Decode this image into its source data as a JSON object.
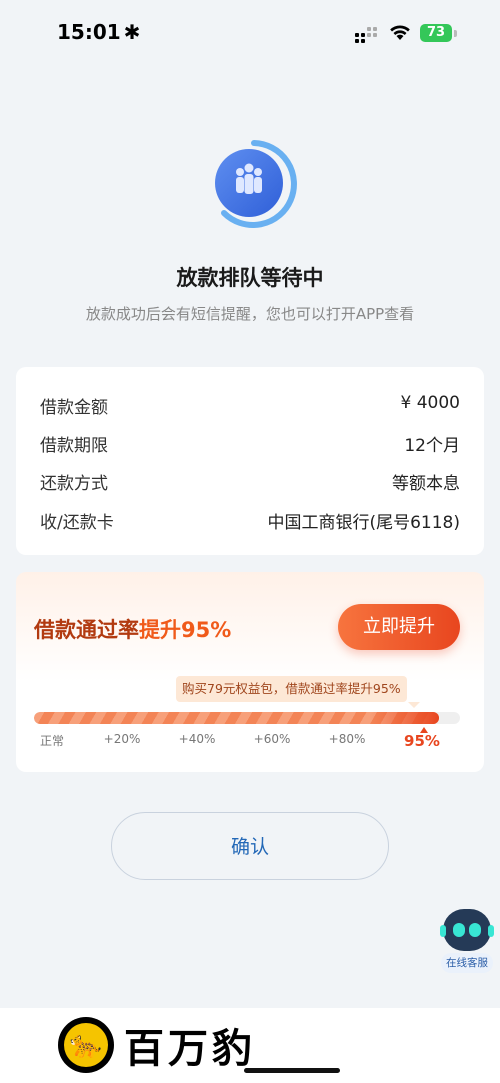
{
  "status_bar": {
    "time": "15:01",
    "sync_glyph": "✱",
    "battery": "73"
  },
  "header": {
    "title": "放款排队等待中",
    "subtitle": "放款成功后会有短信提醒，您也可以打开APP查看"
  },
  "loan_info": [
    {
      "label": "借款金额",
      "value": "¥ 4000"
    },
    {
      "label": "借款期限",
      "value": "12个月"
    },
    {
      "label": "还款方式",
      "value": "等额本息"
    },
    {
      "label": "收/还款卡",
      "value": "中国工商银行(尾号6118)"
    }
  ],
  "boost": {
    "title_prefix": "借款通过率",
    "title_highlight": "提升95%",
    "button_label": "立即提升",
    "tip_text": "购买79元权益包，借款通过率提升95%",
    "progress_percent": 95,
    "ticks": [
      "正常",
      "+20%",
      "+40%",
      "+60%",
      "+80%",
      "95%"
    ]
  },
  "confirm_button": "确认",
  "customer_service": {
    "label": "在线客服"
  },
  "brand": {
    "name": "百万豹",
    "icon": "leopard-icon"
  },
  "colors": {
    "accent": "#e8461f",
    "link": "#2368b7",
    "battery": "#34c759"
  }
}
